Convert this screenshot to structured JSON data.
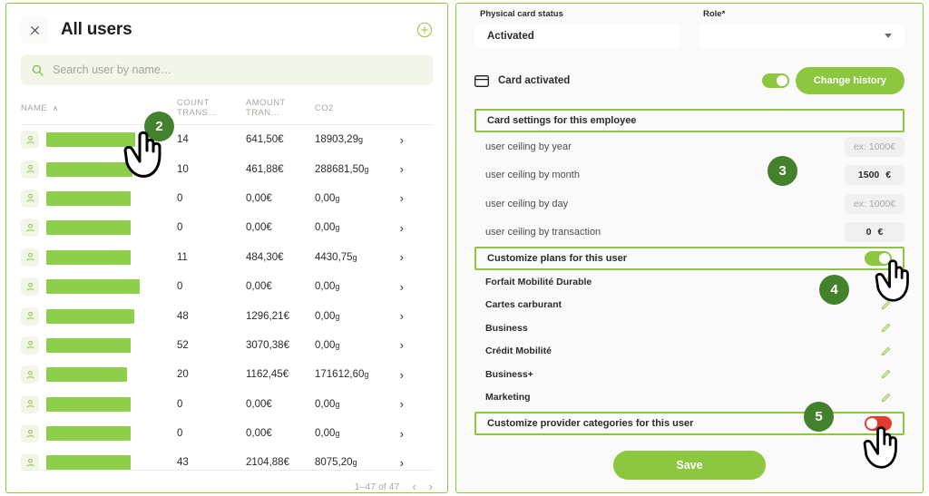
{
  "left_panel": {
    "close_icon": "close-icon",
    "title": "All users",
    "add_icon": "plus-circle-icon",
    "search": {
      "icon": "search-icon",
      "placeholder": "Search user by name…",
      "value": ""
    },
    "columns": [
      "NAME",
      "COUNT TRANS…",
      "AMOUNT TRAN…",
      "CO2"
    ],
    "sort_indicator": "∧",
    "rows": [
      {
        "name_width": 98,
        "count": "14",
        "amount": "641,50€",
        "co2_value": "18903,29",
        "co2_unit": "g"
      },
      {
        "name_width": 95,
        "count": "10",
        "amount": "461,88€",
        "co2_value": "288681,50",
        "co2_unit": "g"
      },
      {
        "name_width": 93,
        "count": "0",
        "amount": "0,00€",
        "co2_value": "0,00",
        "co2_unit": "g"
      },
      {
        "name_width": 93,
        "count": "0",
        "amount": "0,00€",
        "co2_value": "0,00",
        "co2_unit": "g"
      },
      {
        "name_width": 93,
        "count": "11",
        "amount": "484,30€",
        "co2_value": "4430,75",
        "co2_unit": "g"
      },
      {
        "name_width": 103,
        "count": "0",
        "amount": "0,00€",
        "co2_value": "0,00",
        "co2_unit": "g"
      },
      {
        "name_width": 97,
        "count": "48",
        "amount": "1296,21€",
        "co2_value": "0,00",
        "co2_unit": "g"
      },
      {
        "name_width": 93,
        "count": "52",
        "amount": "3070,38€",
        "co2_value": "0,00",
        "co2_unit": "g"
      },
      {
        "name_width": 89,
        "count": "20",
        "amount": "1162,45€",
        "co2_value": "171612,60",
        "co2_unit": "g"
      },
      {
        "name_width": 93,
        "count": "0",
        "amount": "0,00€",
        "co2_value": "0,00",
        "co2_unit": "g"
      },
      {
        "name_width": 93,
        "count": "0",
        "amount": "0,00€",
        "co2_value": "0,00",
        "co2_unit": "g"
      },
      {
        "name_width": 93,
        "count": "43",
        "amount": "2104,88€",
        "co2_value": "8075,20",
        "co2_unit": "g"
      }
    ],
    "row_arrow": "›",
    "pagination": {
      "range": "1–47 of 47",
      "prev": "‹",
      "next": "›"
    }
  },
  "right_panel": {
    "physical_card_status": {
      "label": "Physical card status",
      "value": "Activated"
    },
    "role": {
      "label": "Role*",
      "value": "",
      "caret_icon": "chevron-down-icon"
    },
    "card_activated": {
      "icon": "credit-card-icon",
      "label": "Card activated",
      "toggle_state": "on"
    },
    "change_history_button": "Change history",
    "card_settings_title": "Card settings for this employee",
    "ceilings": [
      {
        "label": "user ceiling by year",
        "value": "",
        "placeholder": "ex: 1000€",
        "filled": false
      },
      {
        "label": "user ceiling by month",
        "value": "1500",
        "currency": "€",
        "filled": true
      },
      {
        "label": "user ceiling by day",
        "value": "",
        "placeholder": "ex: 1000€",
        "filled": false
      },
      {
        "label": "user ceiling by transaction",
        "value": "0",
        "currency": "€",
        "filled": true
      }
    ],
    "customize_plans": {
      "label": "Customize plans for this user",
      "toggle_state": "on"
    },
    "plans": [
      {
        "name": "Forfait Mobilité Durable",
        "edit_icon": "pencil-icon"
      },
      {
        "name": "Cartes carburant",
        "edit_icon": "pencil-icon"
      },
      {
        "name": "Business",
        "edit_icon": "pencil-icon"
      },
      {
        "name": "Crédit Mobilité",
        "edit_icon": "pencil-icon"
      },
      {
        "name": "Business+",
        "edit_icon": "pencil-icon"
      },
      {
        "name": "Marketing",
        "edit_icon": "pencil-icon"
      }
    ],
    "customize_provider_categories": {
      "label": "Customize provider categories for this user",
      "toggle_state": "off"
    },
    "save_button": "Save"
  },
  "annotations": {
    "badges": [
      {
        "number": "2"
      },
      {
        "number": "3"
      },
      {
        "number": "4"
      },
      {
        "number": "5"
      }
    ]
  },
  "colors": {
    "brand_green": "#8dc63f",
    "redaction_green": "#8dcf4a",
    "badge_green": "#43812c",
    "toggle_off_red": "#e23b32",
    "search_bg": "#f2f6e9",
    "panel_bg": "#fafafa"
  }
}
